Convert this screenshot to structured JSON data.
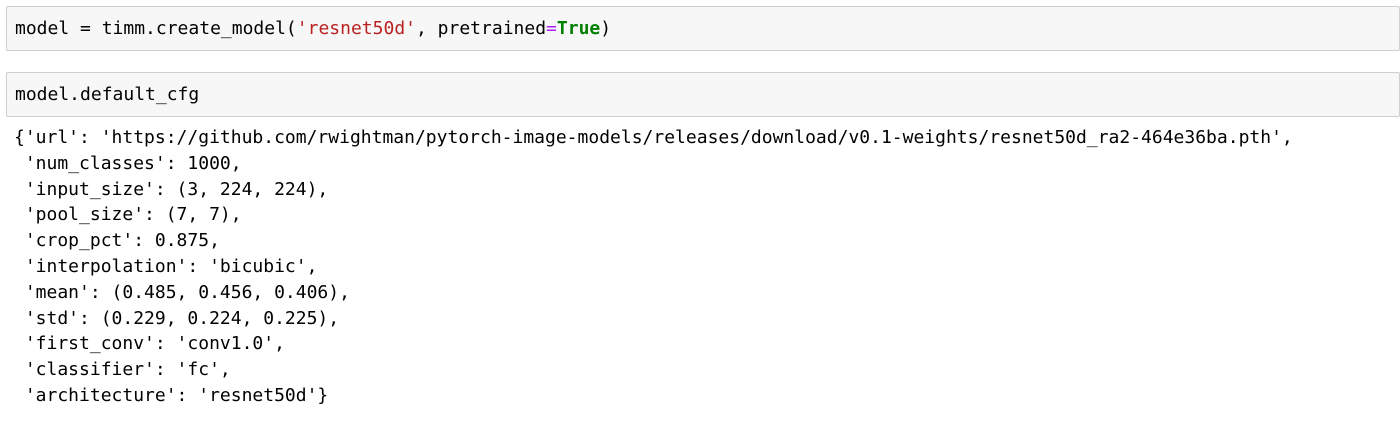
{
  "cell_1": {
    "var": "model",
    "op": " = ",
    "call": "timm.create_model(",
    "arg_str": "'resnet50d'",
    "comma": ", pretrained",
    "eq": "=",
    "kw": "True",
    "close": ")"
  },
  "cell_2": {
    "code": "model.default_cfg"
  },
  "output_lines": [
    "{'url': 'https://github.com/rwightman/pytorch-image-models/releases/download/v0.1-weights/resnet50d_ra2-464e36ba.pth',",
    " 'num_classes': 1000,",
    " 'input_size': (3, 224, 224),",
    " 'pool_size': (7, 7),",
    " 'crop_pct': 0.875,",
    " 'interpolation': 'bicubic',",
    " 'mean': (0.485, 0.456, 0.406),",
    " 'std': (0.229, 0.224, 0.225),",
    " 'first_conv': 'conv1.0',",
    " 'classifier': 'fc',",
    " 'architecture': 'resnet50d'}"
  ]
}
